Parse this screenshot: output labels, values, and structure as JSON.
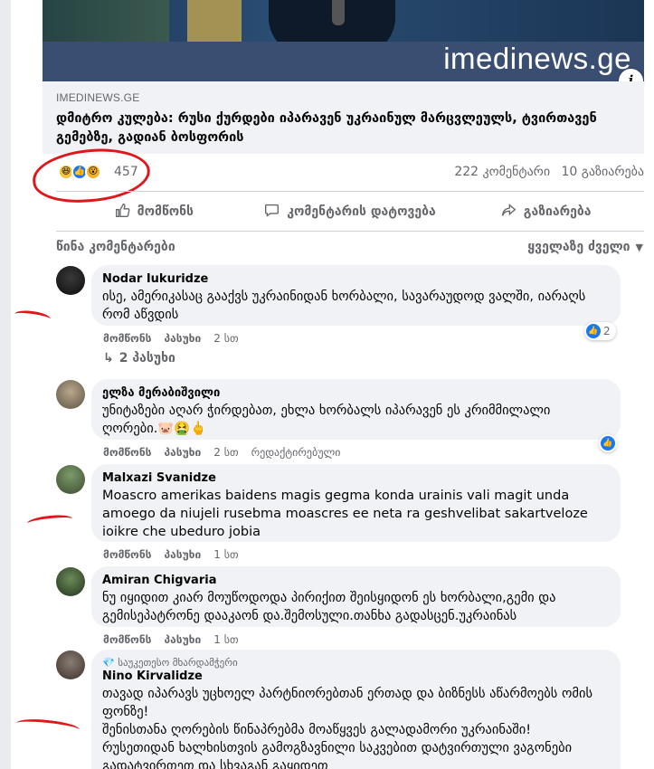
{
  "link_preview": {
    "watermark": "imedinews.ge",
    "domain": "IMEDINEWS.GE",
    "headline": "დმიტრო კულება: რუსი ქურდები იპარავენ უკრაინულ მარცვლეულს, ტვირთავენ გემებზე, გადიან ბოსფორის"
  },
  "stats": {
    "reaction_icons": [
      "haha-icon",
      "like-icon",
      "wow-icon"
    ],
    "reaction_count": "457",
    "comments": "222 კომენტარი",
    "shares": "10 გაზიარება"
  },
  "actions": [
    {
      "label": "მომწონს",
      "icon": "thumbs-up-icon"
    },
    {
      "label": "კომენტარის დატოვება",
      "icon": "comment-icon"
    },
    {
      "label": "გაზიარება",
      "icon": "share-icon"
    }
  ],
  "comments_header": {
    "previous": "წინა კომენტარები",
    "sort": "ყველაზე ძველი"
  },
  "comments": [
    {
      "name": "Nodar Iukuridze",
      "text": "ისე, ამერიკასაც გააქვს უკრაინიდან ხორბალი, სავარაუდოდ ვალში, იარაღს რომ აწვდის",
      "like": "მომწონს",
      "reply": "პასუხი",
      "time": "2 სთ",
      "reactions": "2",
      "replies": "2 პასუხი"
    },
    {
      "name": "ელზა მერაბიშვილი",
      "text": "უნიტაზები აღარ ჭირდებათ, ეხლა ხორბალს იპარავენ ეს კრიმმილალი ღორები.🐷🤮🖕",
      "like": "მომწონს",
      "reply": "პასუხი",
      "time": "2 სთ",
      "edited": "რედაქტირებული"
    },
    {
      "name": "Malxazi Svanidze",
      "text": "Moascro amerikas baidens magis gegma konda urainis vali magit unda amoego da niujeli rusebma moascres ee neta ra geshvelibat sakartveloze ioikre che ubeduro jobia",
      "like": "მომწონს",
      "reply": "პასუხი",
      "time": "1 სთ"
    },
    {
      "name": "Amiran Chigvaria",
      "text": "ნუ იყიდით კიარ მოუწოდოდა პირიქით შეისყიდონ ეს ხორბალი,გემი და გემისეპატრონე დააკაონ და.შემოსული.თანხა გადასცენ.უკრაინას",
      "like": "მომწონს",
      "reply": "პასუხი",
      "time": "1 სთ"
    },
    {
      "badge": "საუკეთესო მხარდამჭერი",
      "name": "Nino Kirvalidze",
      "text_lines": [
        "თავად იპარავს უცხოელ პარტნიორებთან ერთად და ბიზნესს აწარმოებს ომის ფონზე!",
        "შენისთანა ღორების წინაპრებმა მოაწყვეს გალადამორი უკრაინაში!",
        "რუსეთიდან ხალხისთვის გამოგზავნილი საკვებით დატვირთული ვაგონები გადატვირთეთ და სხვაგან გაყიდეთ"
      ]
    }
  ],
  "colors": {
    "bubble": "#f0f2f5",
    "secondary_text": "#65676b",
    "like_blue": "#1877f2",
    "annotation_red": "#e0161a"
  }
}
